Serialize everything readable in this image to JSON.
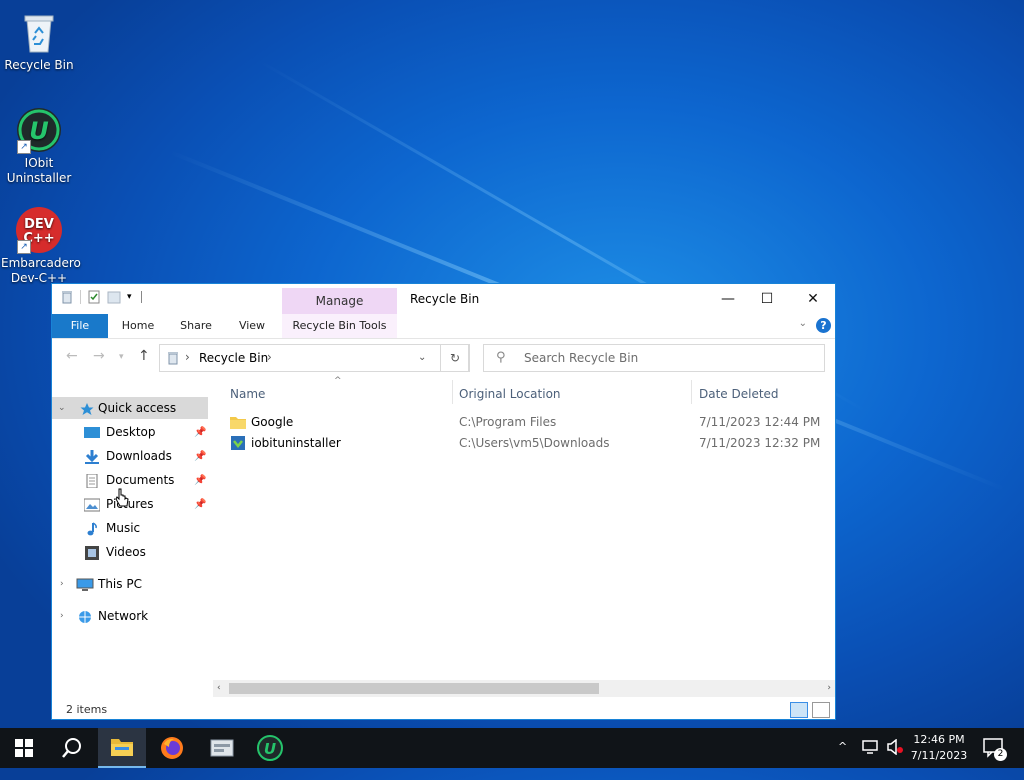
{
  "desktop": {
    "icons": [
      {
        "label": "Recycle Bin"
      },
      {
        "label": "IObit Uninstaller"
      },
      {
        "label": "Embarcadero Dev-C++",
        "glyph": "DEV C++"
      }
    ]
  },
  "window": {
    "title": "Recycle Bin",
    "manage_label": "Manage",
    "ribbon_tabs": {
      "file": "File",
      "home": "Home",
      "share": "Share",
      "view": "View",
      "tools": "Recycle Bin Tools"
    },
    "help_label": "?",
    "controls": {
      "minimize": "—",
      "maximize": "☐",
      "close": "✕"
    },
    "address": {
      "path_item": "Recycle Bin"
    },
    "search": {
      "placeholder": "Search Recycle Bin"
    },
    "nav": {
      "quick_access": "Quick access",
      "items": [
        {
          "label": "Desktop",
          "pinned": true
        },
        {
          "label": "Downloads",
          "pinned": true
        },
        {
          "label": "Documents",
          "pinned": true
        },
        {
          "label": "Pictures",
          "pinned": true
        },
        {
          "label": "Music",
          "pinned": false
        },
        {
          "label": "Videos",
          "pinned": false
        }
      ],
      "this_pc": "This PC",
      "network": "Network"
    },
    "columns": {
      "name": "Name",
      "original_location": "Original Location",
      "date_deleted": "Date Deleted"
    },
    "rows": [
      {
        "name": "Google",
        "original_location": "C:\\Program Files",
        "date_deleted": "7/11/2023 12:44 PM",
        "icon": "folder-icon"
      },
      {
        "name": "iobituninstaller",
        "original_location": "C:\\Users\\vm5\\Downloads",
        "date_deleted": "7/11/2023 12:32 PM",
        "icon": "installer-icon"
      }
    ],
    "status": {
      "item_count": "2 items"
    }
  },
  "taskbar": {
    "apps": [
      "start-icon",
      "search-icon",
      "file-explorer-icon",
      "firefox-icon",
      "recycle-tool-icon",
      "iobit-icon"
    ],
    "clock": {
      "time": "12:46 PM",
      "date": "7/11/2023"
    },
    "notification_count": "2"
  },
  "colors": {
    "accent": "#1979ca",
    "manage_tab": "#efd7f5",
    "taskbar": "#101418"
  }
}
